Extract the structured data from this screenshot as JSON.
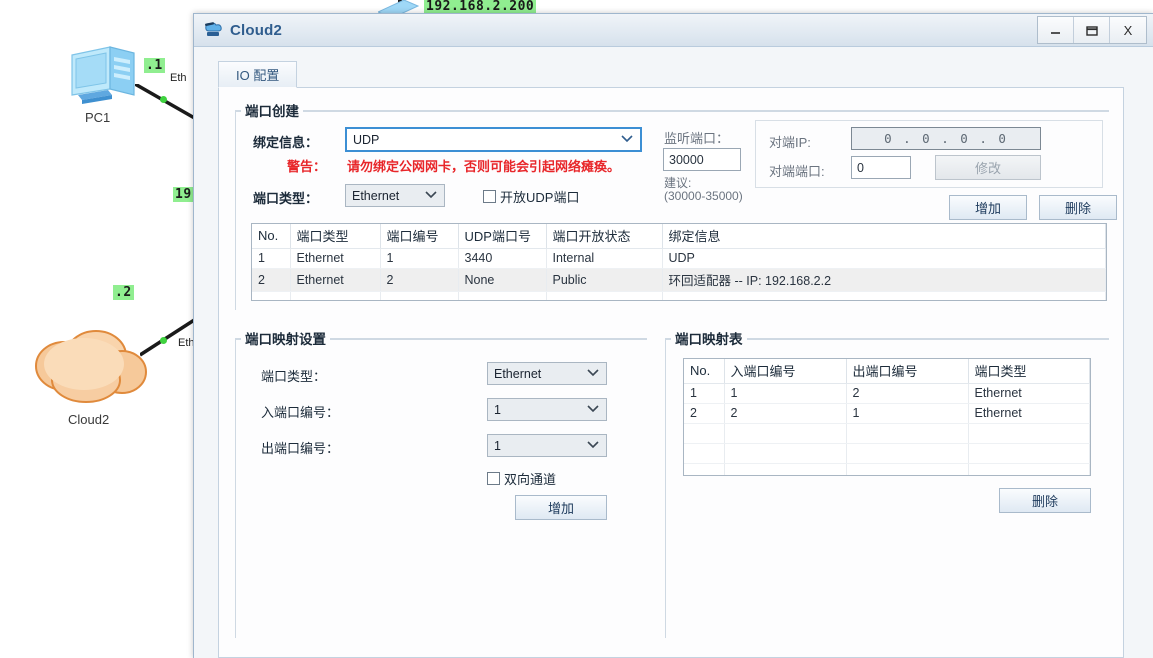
{
  "topology": {
    "ip_top": "192.168.2.200",
    "pc1": {
      "caption": "PC1",
      "badge": ".1",
      "iface": "Eth"
    },
    "cloud2": {
      "caption": "Cloud2",
      "badge": ".2",
      "iface": "Eth"
    },
    "mid_badge": "19"
  },
  "window": {
    "title": "Cloud2",
    "icon": "cloud-device-icon",
    "minimize": "—",
    "maximize": "❐",
    "close": "X"
  },
  "tabs": [
    {
      "label": "IO 配置",
      "active": true
    }
  ],
  "port_create": {
    "title": "端口创建",
    "bind_label": "绑定信息：",
    "bind_value": "UDP",
    "warn_label": "警告：",
    "warn_text": "请勿绑定公网网卡，否则可能会引起网络瘫痪。",
    "porttype_label": "端口类型：",
    "porttype_value": "Ethernet",
    "open_udp_label": "开放UDP端口",
    "listen_label": "监听端口：",
    "listen_value": "30000",
    "suggest_label": "建议:",
    "suggest_range": "(30000-35000)",
    "peer_ip_label": "对端IP:",
    "peer_ip_value": "0 . 0 . 0 . 0",
    "peer_port_label": "对端端口:",
    "peer_port_value": "0",
    "modify_btn": "修改",
    "add_btn": "增加",
    "delete_btn": "删除"
  },
  "port_table": {
    "headers": [
      "No.",
      "端口类型",
      "端口编号",
      "UDP端口号",
      "端口开放状态",
      "绑定信息"
    ],
    "rows": [
      {
        "no": "1",
        "type": "Ethernet",
        "num": "1",
        "udp": "3440",
        "state": "Internal",
        "bind": "UDP",
        "selected": false
      },
      {
        "no": "2",
        "type": "Ethernet",
        "num": "2",
        "udp": "None",
        "state": "Public",
        "bind": "环回适配器 -- IP: 192.168.2.2",
        "selected": true
      }
    ],
    "empty_rows": 4
  },
  "map_settings": {
    "title": "端口映射设置",
    "porttype_label": "端口类型：",
    "porttype_value": "Ethernet",
    "in_label": "入端口编号：",
    "in_value": "1",
    "out_label": "出端口编号：",
    "out_value": "1",
    "bidir_label": "双向通道",
    "add_btn": "增加"
  },
  "map_table": {
    "title": "端口映射表",
    "headers": [
      "No.",
      "入端口编号",
      "出端口编号",
      "端口类型"
    ],
    "rows": [
      {
        "no": "1",
        "in": "1",
        "out": "2",
        "type": "Ethernet"
      },
      {
        "no": "2",
        "in": "2",
        "out": "1",
        "type": "Ethernet"
      }
    ],
    "empty_rows": 3,
    "delete_btn": "删除"
  },
  "colors": {
    "accent": "#2f5d8e",
    "warning": "#e8262a",
    "badge_bg": "#90ee90",
    "link_dot": "#3fd23f"
  }
}
